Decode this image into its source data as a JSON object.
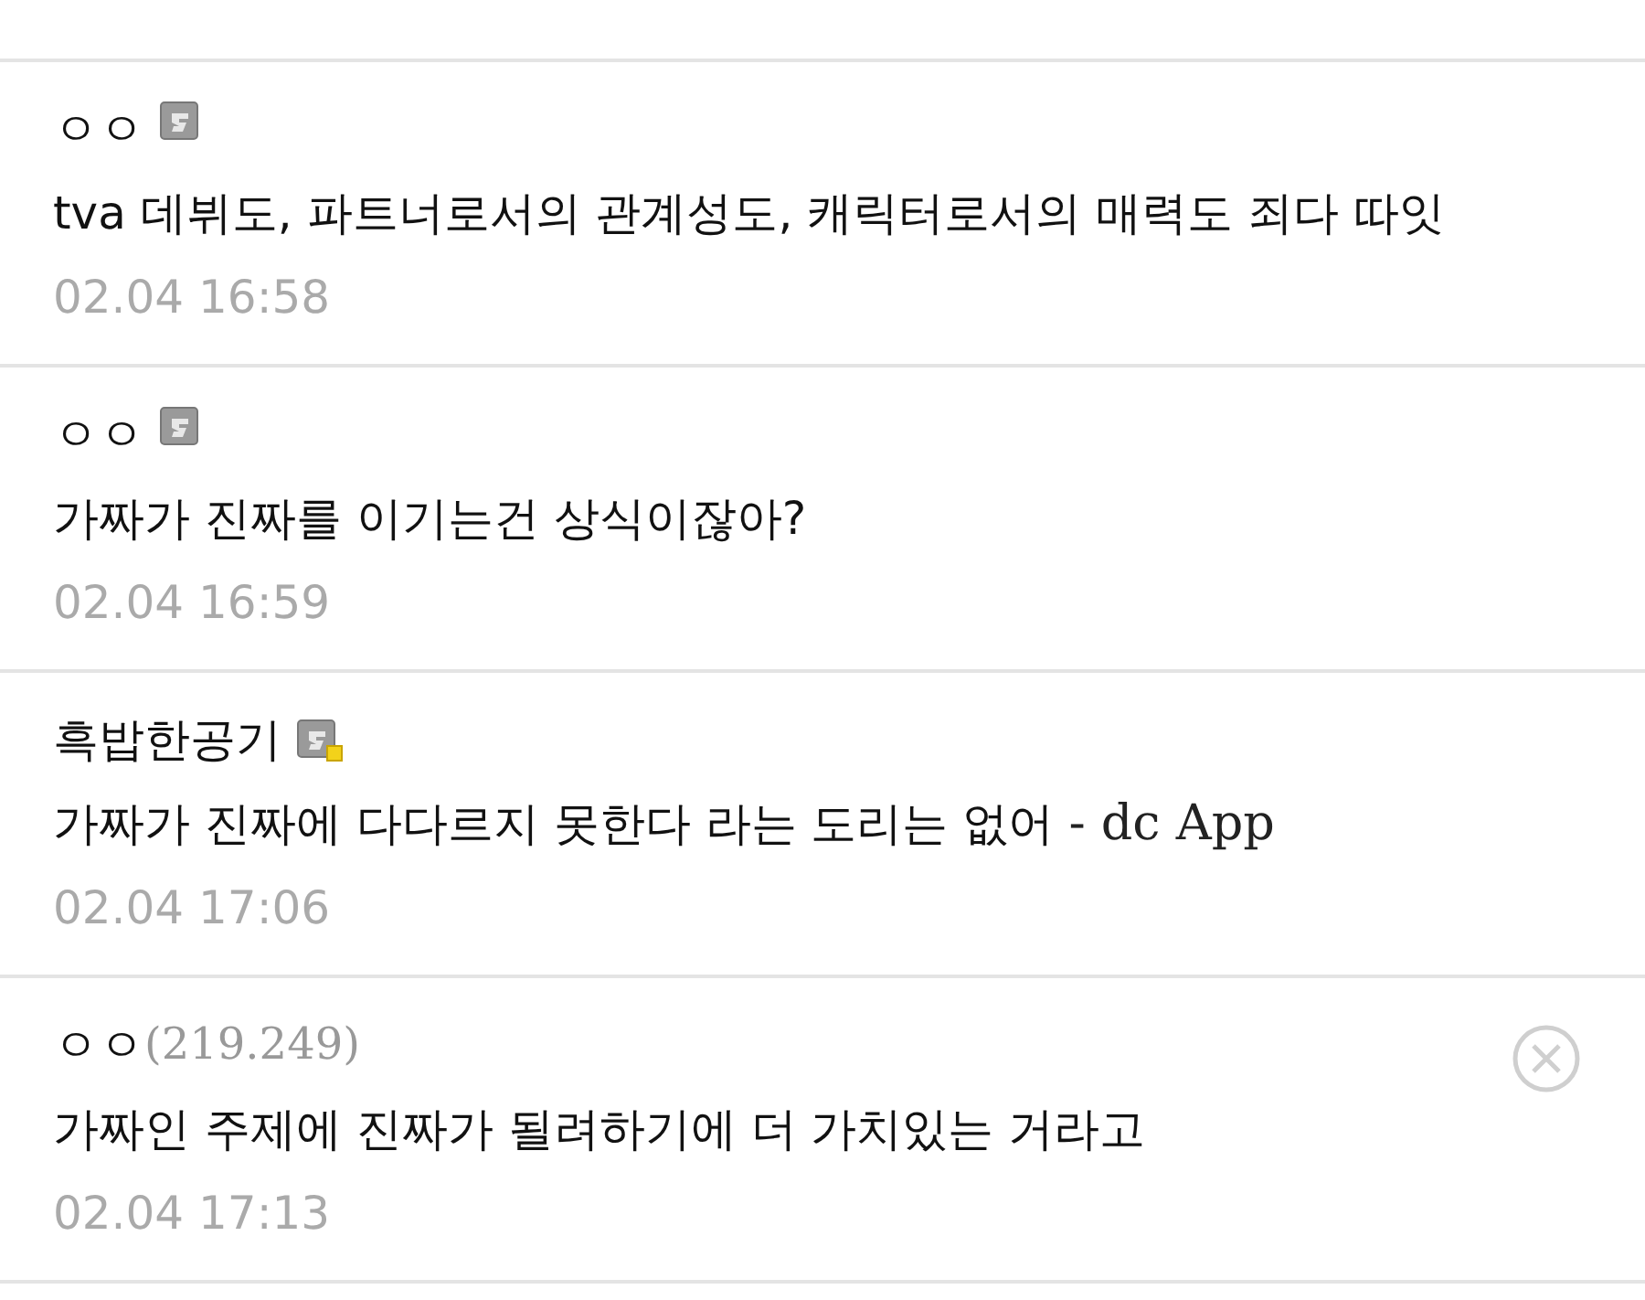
{
  "comments": [
    {
      "nickname": "ㅇㅇ",
      "kind": "member",
      "text": "tva 데뷔도, 파트너로서의 관계성도, 캐릭터로서의 매력도 죄다 따잇",
      "date": "02.04 16:58",
      "deletable": false
    },
    {
      "nickname": "ㅇㅇ",
      "kind": "member",
      "text": "가짜가 진짜를 이기는건 상식이잖아?",
      "date": "02.04 16:59",
      "deletable": false
    },
    {
      "nickname": "흑밥한공기",
      "kind": "member-new",
      "text": "가짜가 진짜에 다다르지 못한다 라는 도리는 없어",
      "via": "- dc App",
      "date": "02.04 17:06",
      "deletable": false
    },
    {
      "nickname": "ㅇㅇ",
      "kind": "guest",
      "ip": "(219.249)",
      "text": "가짜인 주제에 진짜가 될려하기에 더 가치있는 거라고",
      "date": "02.04 17:13",
      "deletable": true
    }
  ]
}
